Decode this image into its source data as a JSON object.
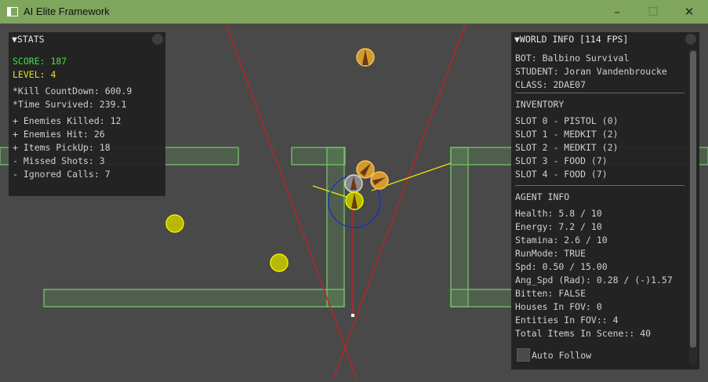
{
  "window": {
    "title": "AI Elite Framework",
    "minimize": "–",
    "maximize": "☐",
    "close": "✕"
  },
  "stats": {
    "header": "▼STATS",
    "score": "SCORE: 187",
    "level": "LEVEL: 4",
    "lines": [
      "*Kill CountDown: 600.9",
      "*Time Survived: 239.1",
      "+ Enemies Killed: 12",
      "+ Enemies Hit: 26",
      "+ Items PickUp: 18",
      "- Missed Shots: 3",
      "- Ignored Calls: 7"
    ]
  },
  "world": {
    "header": "▼WORLD INFO [114 FPS]",
    "bot": "BOT: Balbino Survival",
    "student": "STUDENT: Joran Vandenbroucke",
    "class": "CLASS: 2DAE07",
    "inventory_title": "INVENTORY",
    "slots": [
      "SLOT 0 - PISTOL (0)",
      "SLOT 1 - MEDKIT (2)",
      "SLOT 2 - MEDKIT (2)",
      "SLOT 3 - FOOD (7)",
      "SLOT 4 - FOOD (7)"
    ],
    "agent_title": "AGENT INFO",
    "agent": [
      "Health: 5.8 / 10",
      "Energy: 7.2 / 10",
      "Stamina: 2.6 / 10",
      "RunMode: TRUE",
      "Spd: 0.50 / 15.00",
      "Ang_Spd (Rad): 0.28 / (-)1.57",
      "Bitten: FALSE",
      "Houses In FOV: 0",
      "Entities In FOV:: 4",
      "Total Items In Scene:: 40"
    ],
    "auto_follow": "Auto Follow"
  },
  "colors": {
    "wall": "#74c46a",
    "score": "#3fe03f",
    "level": "#e0e030",
    "fov": "#c82020",
    "ray": "#e8e800"
  }
}
